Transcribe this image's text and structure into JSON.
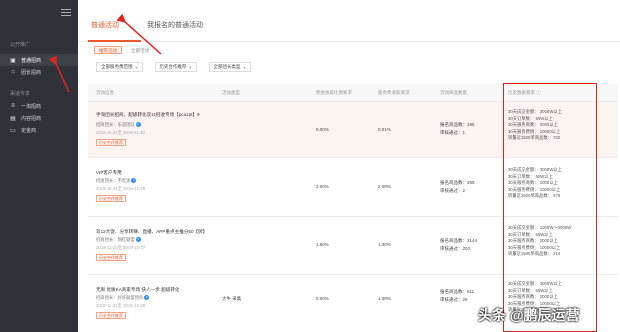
{
  "sidebar": {
    "section1": "公开推广",
    "items1": [
      {
        "label": "普通招商",
        "icon": "storefront-icon",
        "active": true
      },
      {
        "label": "团长招商",
        "icon": "home-icon",
        "active": false
      }
    ],
    "section2": "渠道专享",
    "items2": [
      {
        "label": "一淘招商",
        "icon": "list-icon"
      },
      {
        "label": "内容招商",
        "icon": "document-icon"
      },
      {
        "label": "定金商",
        "icon": "wallet-icon"
      }
    ]
  },
  "tabs": [
    {
      "label": "普通活动",
      "active": true
    },
    {
      "label": "我报名的普通活动",
      "active": false
    }
  ],
  "subtabs": [
    {
      "label": "推荐活动",
      "active": true
    },
    {
      "label": "全部活动",
      "active": false
    }
  ],
  "filters": [
    "全部服务费范围",
    "历史合作推荐",
    "全部团长类型"
  ],
  "table": {
    "headers": [
      "活动信息",
      "活动类型",
      "佣金收取比例要求",
      "服务费收取要求",
      "活动商品数量",
      "历史数据要求 ⓘ"
    ],
    "rows": [
      {
        "title": "手淘团长招商，超级转化双11招收专场【pcuzpt】9",
        "meta": "招商团长：乐途团队",
        "date": "2019-11-24至 2019-11-30",
        "btn": "历史合作推荐",
        "type": "",
        "commission": "5.00%",
        "service": "0.01%",
        "goods": [
          "报名商品数：195",
          "审核通过：1"
        ],
        "conds": [
          "30天成交金额：  3000W以上",
          "30天订单数：  50W以上",
          "30天服务商数：  2000以上",
          "30天服务费佣：  10000以上",
          "转量近1500单商品数：  702"
        ]
      },
      {
        "title": "VIP客户专用",
        "meta": "招商团长：不吃饭",
        "date": "2019-11-24至 2019-12-29",
        "btn": "历史合作推荐",
        "type": "",
        "commission": "2.00%",
        "service": "2.00%",
        "goods": [
          "报名商品数：255",
          "审核通过：2"
        ],
        "conds": [
          "30天成交金额：  3000W以上",
          "30天订单数：  50W以上",
          "30天服务商数：  2000以上",
          "30天服务费佣：  10000以上",
          "转量近1500单商品数：  479"
        ]
      },
      {
        "title": "双12大促、分享转赚、直播、APP重点主推分50【牌】",
        "meta": "招商团长：网红联盟",
        "date": "2019-11-25至 2019-12-27",
        "btn": "历史合作推荐",
        "type": "",
        "commission": "1.50%",
        "service": "1.00%",
        "goods": [
          "报名商品数：2144",
          "审核通过：203"
        ],
        "conds": [
          "30天成交金额：  1000W～3000W",
          "30天订单数：  50W以上",
          "30天服务商数：  2000以上",
          "30天服务费佣：  10000以上",
          "转量近1500单商品数：  214"
        ]
      },
      {
        "title": "无限 优质KA商家专场 快人一步 超级转化",
        "meta": "招商团长：好好联盟团队",
        "date": "2019-11-21至 2019-12-29",
        "btn": "历史合作推荐",
        "type": "大牛  采集",
        "commission": "5.00%",
        "service": "1.00%",
        "goods": [
          "报名商品数：511",
          "审核通过：26"
        ],
        "conds": [
          "30天成交金额：  3000W以上",
          "30天订单数：  50W以上",
          "30天服务商数：  2000以上",
          "30天服务费佣：  10000以上",
          "转量近1500单商品数：  455"
        ]
      }
    ]
  },
  "watermark": "头条 @鹏辰运营",
  "colors": {
    "accent": "#e8582b",
    "annotation": "#e0231b",
    "sidebar_bg": "#2f3339"
  }
}
